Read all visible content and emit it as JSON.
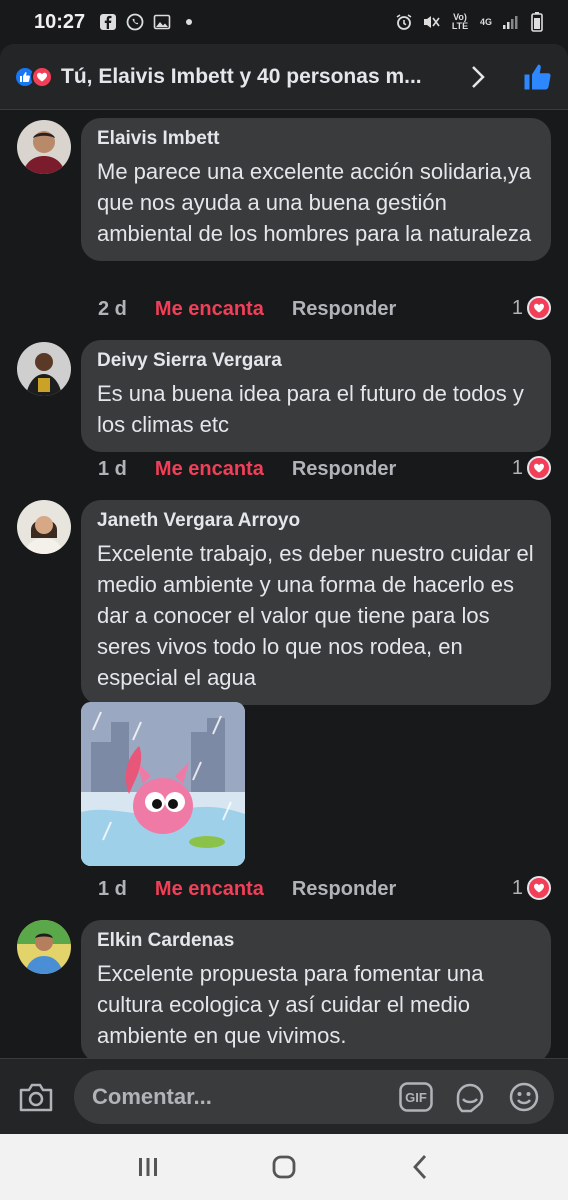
{
  "status_bar": {
    "time": "10:27",
    "network_label": "Vo) LTE",
    "network_type": "4G"
  },
  "header": {
    "title": "Tú, Elaivis Imbett y 40 personas m...",
    "icons": [
      "like-reaction-icon",
      "love-reaction-icon",
      "chevron-right-icon",
      "thumbs-up-icon"
    ]
  },
  "comments": [
    {
      "author": "Elaivis Imbett",
      "text": "Me parece una excelente acción solidaria,ya que nos ayuda a una buena gestión ambiental de los hombres para la naturaleza",
      "time": "2 d",
      "reaction_label": "Me encanta",
      "reply_label": "Responder",
      "reaction_count": "1"
    },
    {
      "author": "Deivy Sierra Vergara",
      "text": "Es una buena idea para  el futuro de todos y los climas etc",
      "time": "1 d",
      "reaction_label": "Me encanta",
      "reply_label": "Responder",
      "reaction_count": "1"
    },
    {
      "author": "Janeth Vergara Arroyo",
      "text": "Excelente trabajo,  es deber nuestro cuidar el medio ambiente y una forma de hacerlo es dar a conocer el valor que tiene para los seres vivos todo lo que nos rodea, en especial el agua",
      "time": "1 d",
      "reaction_label": "Me encanta",
      "reply_label": "Responder",
      "reaction_count": "1"
    },
    {
      "author": "Elkin Cardenas",
      "text": "Excelente propuesta para fomentar una cultura ecologica y así cuidar el medio ambiente en que vivimos."
    }
  ],
  "composer": {
    "placeholder": "Comentar...",
    "gif_label": "GIF"
  },
  "colors": {
    "background": "#18191a",
    "bubble": "#3a3b3c",
    "love": "#f33e58",
    "like": "#1877f2"
  }
}
